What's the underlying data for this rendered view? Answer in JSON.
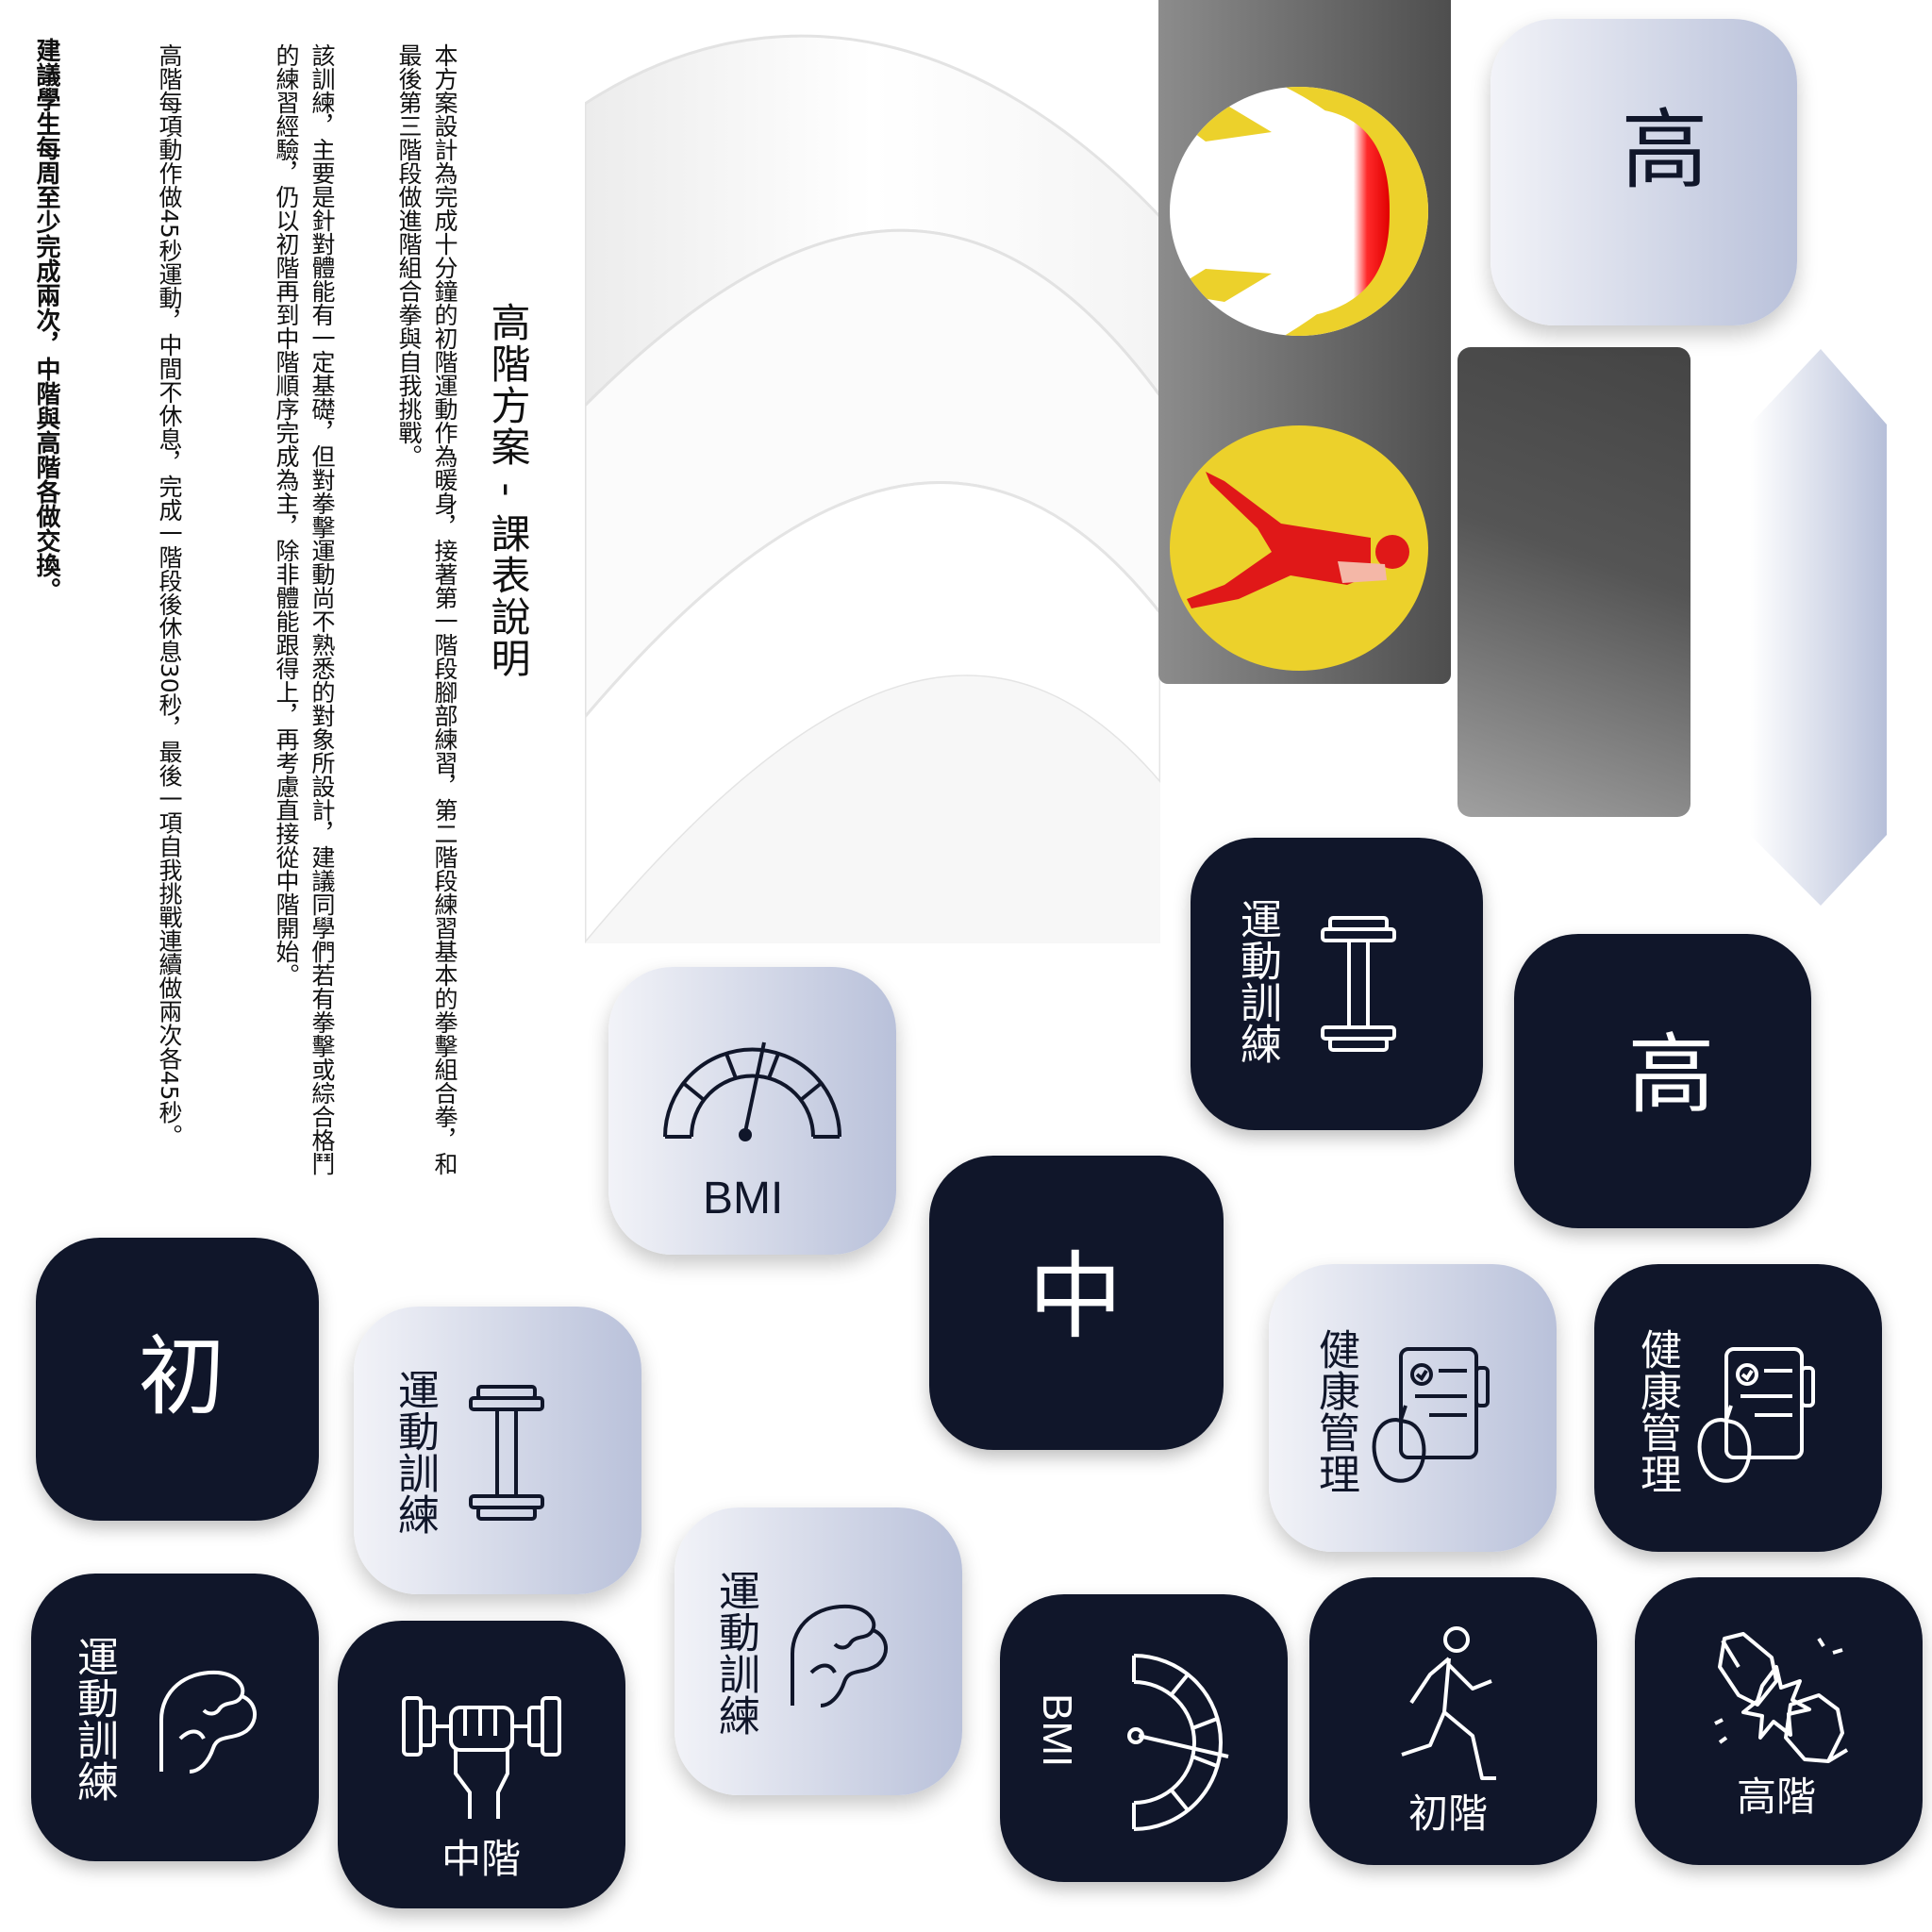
{
  "doc": {
    "title": "高階方案 - 課表說明",
    "para1": "本方案設計為完成十分鐘的初階運動作為暖身，接著第一階段腳部練習，第二階段練習基本的拳擊組合拳，和最後第三階段做進階組合拳與自我挑戰。",
    "para2": "該訓練，主要是針對體能有一定基礎，但對拳擊運動尚不熟悉的對象所設計，建議同學們若有拳擊或綜合格鬥的練習經驗，仍以初階再到中階順序完成為主，除非體能跟得上，再考慮直接從中階開始。",
    "para3": "高階每項動作做45秒運動，中間不休息，完成一階段後休息30秒，最後一項自我挑戰連續做兩次各45秒。",
    "para4": "建議學生每周至少完成兩次，中階與高階各做交換。"
  },
  "tiles": {
    "gao_light": "高",
    "gao_dark": "高",
    "zhong": "中",
    "chu": "初",
    "training": "運動訓練",
    "health": "健康管理",
    "bmi": "BMI",
    "beginner": "初階",
    "intermediate": "中階",
    "advanced": "高階"
  },
  "colors": {
    "dark_navy": "#10162a",
    "light_gradient_start": "#f2f3f8",
    "light_gradient_end": "#b9c1da",
    "accent_yellow": "#ecd12b",
    "accent_red": "#e01818",
    "panel_gray": "#5f5f5f"
  }
}
